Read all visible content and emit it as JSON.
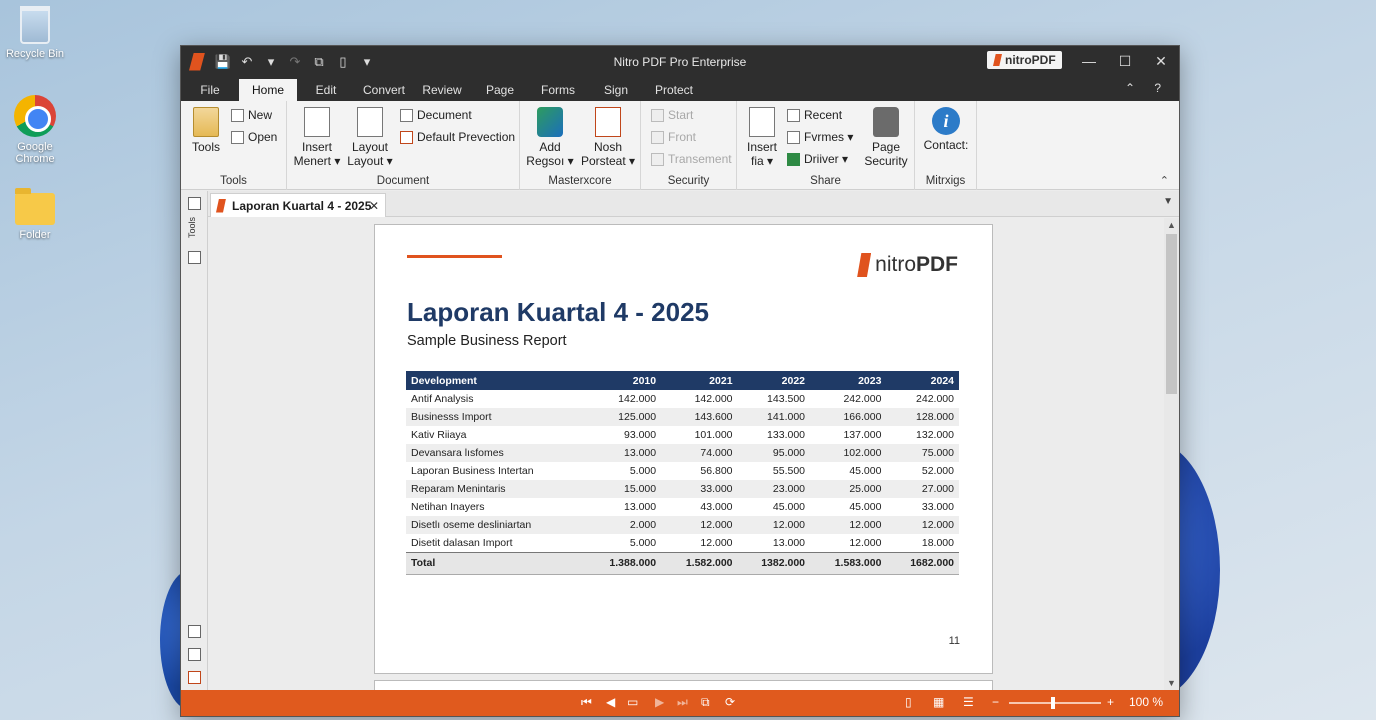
{
  "desktop": {
    "icons": [
      {
        "label": "Recycle Bin"
      },
      {
        "label": "Google Chrome"
      },
      {
        "label": "Folder"
      }
    ]
  },
  "window": {
    "title": "Nitro PDF Pro Enterprise",
    "brand_badge": "nitroPDF",
    "qat": {
      "save": "💾",
      "undo": "↶",
      "dropdown": "▾",
      "redo": "↷",
      "pin": "⇧"
    },
    "controls": {
      "minimize": "—",
      "maximize": "☐",
      "close": "✕"
    }
  },
  "menu": {
    "tabs": [
      "File",
      "Home",
      "Edit",
      "Convert",
      "Review",
      "Page",
      "Forms",
      "Sign",
      "Protect"
    ],
    "active": "Home",
    "right_icons": "⌃ ?"
  },
  "ribbon": {
    "groups": {
      "tools": {
        "label": "Tools",
        "button": "Tools"
      },
      "new_open": {
        "new": "New",
        "open": "Open"
      },
      "document": {
        "label": "Document",
        "insert": [
          "Insert",
          "Menert ▾"
        ],
        "layout": [
          "Layout",
          "Layout ▾"
        ],
        "decument": "Decument",
        "default_prevection": "Default Prevection"
      },
      "masterxcore": {
        "label": "Masterxcore",
        "add": [
          "Add",
          "Regsoı ▾"
        ],
        "nosh": [
          "Nosh",
          "Porsteat ▾"
        ]
      },
      "security": {
        "label": "Security",
        "start": "Start",
        "front": "Front",
        "transement": "Transement"
      },
      "share": {
        "label": "Share",
        "insert": [
          "Insert",
          "fia ▾"
        ],
        "recent": "Recent",
        "formes": "Fvrmes ▾",
        "driver": "Driiver ▾",
        "page_security": [
          "Page",
          "Security"
        ]
      },
      "mitrxigs": {
        "label": "Mitrxigs",
        "contact": "Contact:"
      }
    },
    "collapse": "⌃"
  },
  "doc_tab": {
    "title": "Laporan Kuartal 4 - 2025",
    "close": "✕"
  },
  "side_panel": {
    "label": "Tools"
  },
  "document": {
    "logo": {
      "light": "nitro",
      "bold": "PDF"
    },
    "title": "Laporan Kuartal 4 - 2025",
    "subtitle": "Sample Business Report",
    "table": {
      "headers": [
        "Development",
        "2010",
        "2021",
        "2022",
        "2023",
        "2024"
      ],
      "rows": [
        [
          "Antif Analysis",
          "142.000",
          "142.000",
          "143.500",
          "242.000",
          "242.000"
        ],
        [
          "Businesss Import",
          "125.000",
          "143.600",
          "141.000",
          "166.000",
          "128.000"
        ],
        [
          "Kativ Riiaya",
          "93.000",
          "101.000",
          "133.000",
          "137.000",
          "132.000"
        ],
        [
          "Devansara lısfomes",
          "13.000",
          "74.000",
          "95.000",
          "102.000",
          "75.000"
        ],
        [
          "Laporan Business Intertan",
          "5.000",
          "56.800",
          "55.500",
          "45.000",
          "52.000"
        ],
        [
          "Reparam Menintaris",
          "15.000",
          "33.000",
          "23.000",
          "25.000",
          "27.000"
        ],
        [
          "Netihan Inayers",
          "13.000",
          "43.000",
          "45.000",
          "45.000",
          "33.000"
        ],
        [
          "Disetlı oseme desliniartan",
          "2.000",
          "12.000",
          "12.000",
          "12.000",
          "12.000"
        ],
        [
          "Disetit dalasan Import",
          "5.000",
          "12.000",
          "13.000",
          "12.000",
          "18.000"
        ]
      ],
      "total": [
        "Total",
        "1.388.000",
        "1.582.000",
        "1382.000",
        "1.583.000",
        "1682.000"
      ]
    },
    "page_number": "11"
  },
  "statusbar": {
    "nav": {
      "first": "⏮",
      "prev": "◀",
      "page_box": "▭",
      "next": "▶",
      "last": "⏭"
    },
    "zoom_out": "−",
    "zoom_in": "+",
    "zoom": "100 %",
    "zoom_level": 0.48
  }
}
